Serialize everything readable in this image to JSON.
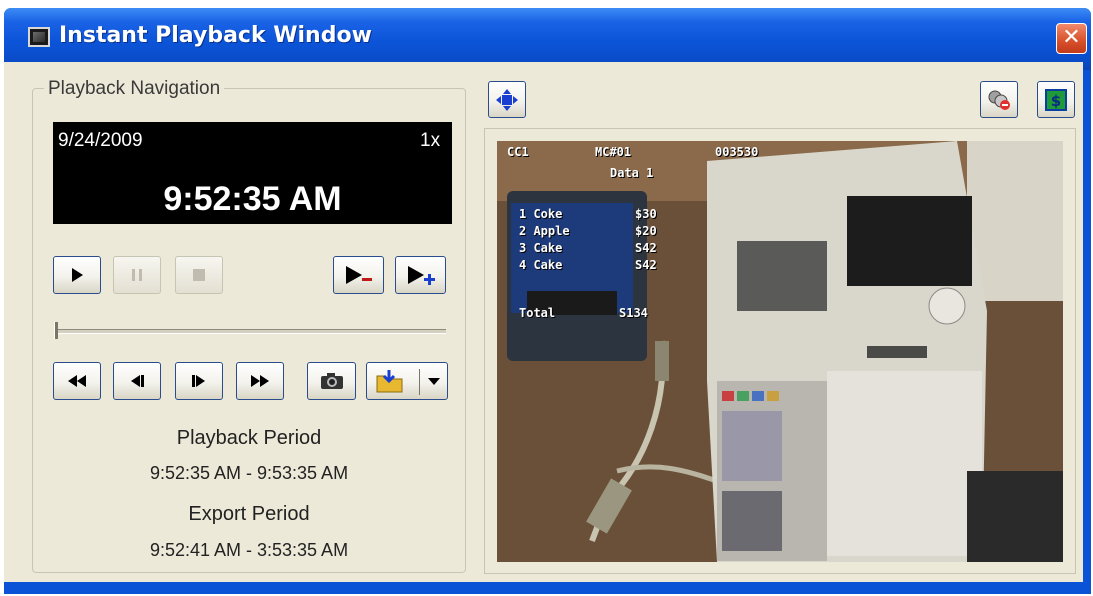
{
  "window": {
    "title": "Instant Playback Window"
  },
  "navigation": {
    "group_label": "Playback Navigation",
    "display": {
      "date": "9/24/2009",
      "speed": "1x",
      "time": "9:52:35 AM"
    },
    "slider_position": 0.0,
    "playback_period_label": "Playback Period",
    "playback_period_value": "9:52:35 AM - 9:53:35 AM",
    "export_period_label": "Export Period",
    "export_period_value": "9:52:41 AM - 3:53:35 AM"
  },
  "video_overlay": {
    "camera": "CC1",
    "register": "MC#01",
    "id": "003530",
    "data_line": "Data 1",
    "items": [
      {
        "label": "1 Coke",
        "price": "$30"
      },
      {
        "label": "2 Apple",
        "price": "$20"
      },
      {
        "label": "3 Cake",
        "price": "S42"
      },
      {
        "label": "4 Cake",
        "price": "S42"
      }
    ],
    "total_label": "Total",
    "total_value": "S134"
  },
  "colors": {
    "titlebar": "#0a52d6",
    "client_bg": "#ece9d8",
    "display_bg": "#000000",
    "close_button": "#d9532e"
  },
  "icons": {
    "title": "window-icon",
    "close": "close-icon",
    "play": "play-icon",
    "pause": "pause-icon",
    "stop": "stop-icon",
    "mark_out": "mark-out-icon",
    "mark_in": "mark-in-icon",
    "rewind": "fast-rewind-icon",
    "step_back": "step-back-icon",
    "step_forward": "step-forward-icon",
    "fast_forward": "fast-forward-icon",
    "snapshot": "camera-icon",
    "export": "export-folder-icon",
    "fit": "fit-window-icon",
    "unlink": "link-icon",
    "pos": "dollar-icon"
  }
}
